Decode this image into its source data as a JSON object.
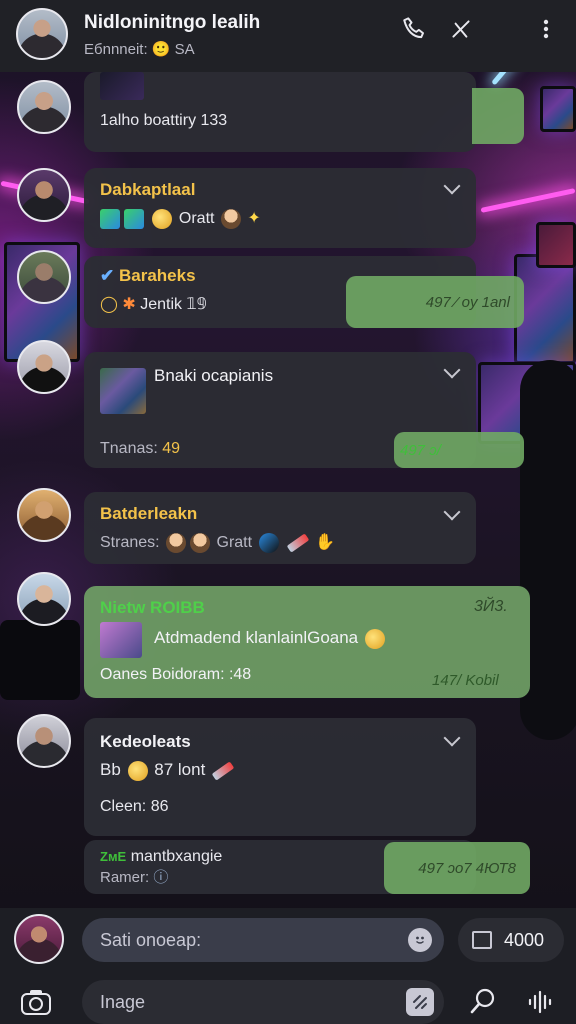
{
  "header": {
    "title": "Nidloninitngo lealih",
    "subtitle": "Eбnnneit: 🙂 SA"
  },
  "messages": [
    {
      "text": "1alho boattiry 133"
    },
    {
      "name": "Dabkaptlaal",
      "text": "Oratt"
    },
    {
      "name": "Baraheks",
      "text": "Jentik 𝟙𝟡",
      "reply_time": "497 ⁄ oy 1anl"
    },
    {
      "name": "Bnaki ocapianis",
      "sub": "Tnanas:",
      "sub_num": "49",
      "time": "497 ɔ/"
    },
    {
      "name": "Batderleakn",
      "sub": "Stranes:",
      "sub2": "Gratt"
    },
    {
      "name": "Nietw ROIBB",
      "name_right": "3Й3.",
      "text": "Atdmadend klanlainlGoana",
      "sub": "Oanes Boidoram: :48",
      "time": "147/ Kobil"
    },
    {
      "name": "Kedeoleats",
      "line1": "Bb",
      "line1b": "87 lont",
      "line2": "Cleen: 86"
    },
    {
      "name": "mantbxangie",
      "sub": "Ramer:",
      "reply_time": "497 ɔo7 4ЮТ8"
    }
  ],
  "composer": {
    "placeholder": "Sati onoeap:",
    "count": "4000",
    "image_label": "Inage"
  }
}
